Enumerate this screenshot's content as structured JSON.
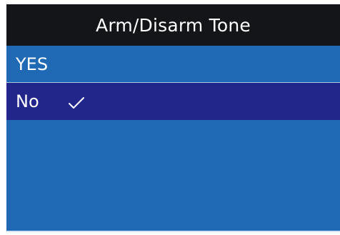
{
  "screen": {
    "title": "Arm/Disarm Tone"
  },
  "menu": {
    "items": [
      {
        "label": "YES",
        "selected": false
      },
      {
        "label": "No",
        "selected": true
      }
    ],
    "selected_icon": "check-icon"
  },
  "colors": {
    "background": "#1f69b5",
    "title_bar": "#131518",
    "selected_row": "#22268a",
    "text": "#ffffff"
  }
}
